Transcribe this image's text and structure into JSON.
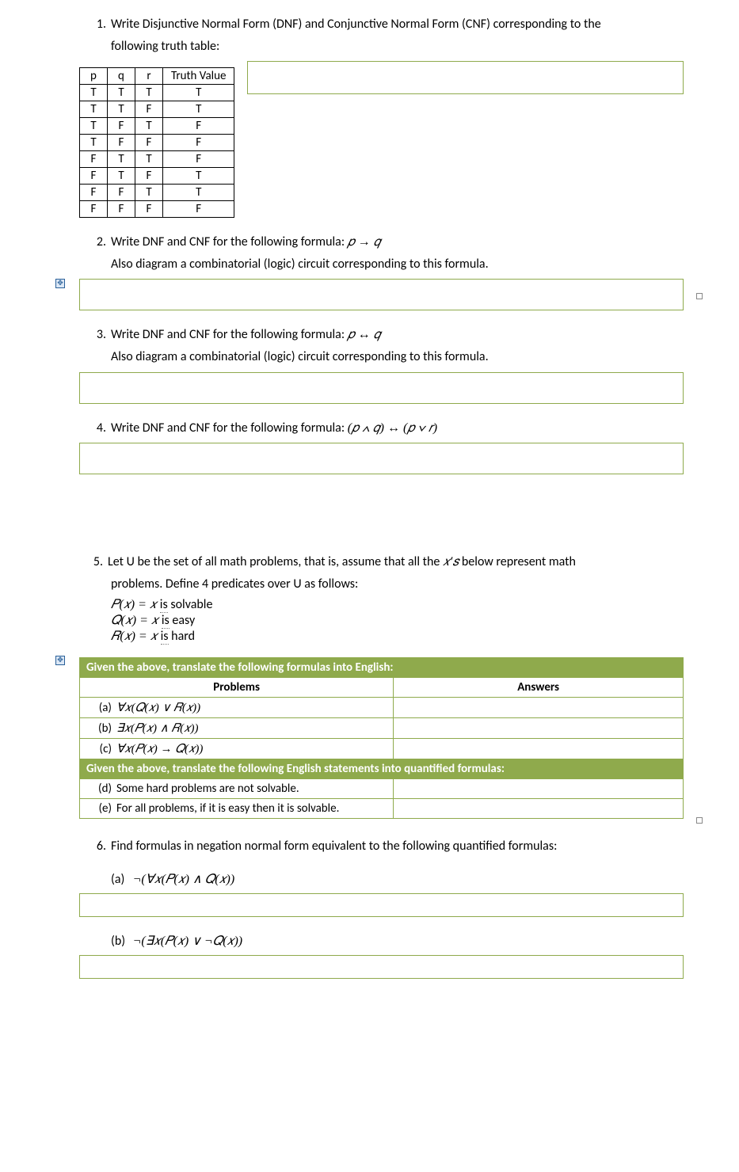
{
  "q1": {
    "num": "1.",
    "text_a": "Write Disjunctive Normal Form (DNF) and Conjunctive Normal Form (CNF) corresponding to the",
    "text_b": "following truth table:",
    "table": {
      "headers": [
        "p",
        "q",
        "r",
        "Truth Value"
      ],
      "rows": [
        [
          "T",
          "T",
          "T",
          "T"
        ],
        [
          "T",
          "T",
          "F",
          "T"
        ],
        [
          "T",
          "F",
          "T",
          "F"
        ],
        [
          "T",
          "F",
          "F",
          "F"
        ],
        [
          "F",
          "T",
          "T",
          "F"
        ],
        [
          "F",
          "T",
          "F",
          "T"
        ],
        [
          "F",
          "F",
          "T",
          "T"
        ],
        [
          "F",
          "F",
          "F",
          "F"
        ]
      ]
    }
  },
  "q2": {
    "num": "2.",
    "text_a": "Write DNF and CNF for the following formula:  ",
    "formula": "𝑝 → 𝑞",
    "text_b": "Also diagram a combinatorial (logic) circuit corresponding to this formula."
  },
  "q3": {
    "num": "3.",
    "text_a": "Write DNF and CNF for the following formula:  ",
    "formula": "𝑝 ↔ 𝑞",
    "text_b": "Also diagram a combinatorial (logic) circuit corresponding to this formula."
  },
  "q4": {
    "num": "4.",
    "text_a": "Write DNF and CNF for the following formula:  ",
    "formula": "(𝑝 ∧ 𝑞) ↔ (𝑝 ∨ 𝑟)"
  },
  "q5": {
    "num": "5.",
    "text_a": "Let U be the set of all math problems, that is, assume that all the ",
    "xs": "𝑥′𝑠",
    "text_a2": " below represent math",
    "text_b": "problems.  Define 4 predicates over U as follows:",
    "pred_p_lhs": "𝑃(𝑥) = 𝑥 ",
    "pred_p_rhs_is": "is",
    "pred_p_rhs_word": " solvable",
    "pred_q_lhs": "𝑄(𝑥) = 𝑥 ",
    "pred_q_rhs_is": "is",
    "pred_q_rhs_word": " easy",
    "pred_r_lhs": "𝑅(𝑥) = 𝑥 ",
    "pred_r_rhs_is": "is",
    "pred_r_rhs_word": " hard",
    "table": {
      "header1": "Given the above, translate the following formulas into English:",
      "col_problems": "Problems",
      "col_answers": "Answers",
      "row_a_label": "(a)",
      "row_a_formula": "∀𝑥(𝑄(𝑥) ∨ 𝑅(𝑥))",
      "row_b_label": "(b)",
      "row_b_formula": "∃𝑥(𝑃(𝑥) ∧ 𝑅(𝑥))",
      "row_c_label": "(c)",
      "row_c_formula": "∀𝑥(𝑃(𝑥) → 𝑄(𝑥))",
      "header2": "Given the above, translate the following English statements into quantified formulas:",
      "row_d_label": "(d)",
      "row_d_text": "Some hard problems are not solvable.",
      "row_e_label": "(e)",
      "row_e_text": "For all problems, if it is easy then it is solvable."
    }
  },
  "q6": {
    "num": "6.",
    "text_a": "Find formulas in negation normal form equivalent to the following quantified formulas:",
    "a_label": "(a)",
    "a_formula": "¬(∀𝑥(𝑃(𝑥) ∧ 𝑄(𝑥))",
    "b_label": "(b)",
    "b_formula": "¬(∃𝑥(𝑃(𝑥) ∨ ¬𝑄(𝑥))"
  },
  "anchor_glyph": "✥"
}
